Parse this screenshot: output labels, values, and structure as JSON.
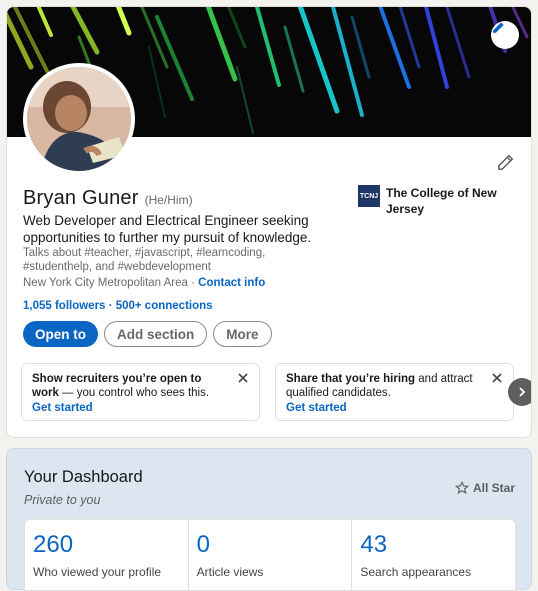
{
  "profile": {
    "name": "Bryan Guner",
    "pronouns": "(He/Him)",
    "headline": "Web Developer and Electrical Engineer seeking opportunities to further my pursuit of knowledge.",
    "talks_about": "Talks about #teacher, #javascript, #learncoding, #studenthelp, and #webdevelopment",
    "location": "New York City Metropolitan Area",
    "location_separator": " · ",
    "contact_info": "Contact info",
    "followers": "1,055 followers",
    "connections_separator": " · ",
    "connections": "500+ connections"
  },
  "school": {
    "logo_text": "TCNJ",
    "name": "The College of New Jersey"
  },
  "actions": {
    "open_to": "Open to",
    "add_section": "Add section",
    "more": "More"
  },
  "suggestions": [
    {
      "text_strong": "Show recruiters you’re open to work",
      "text_rest": " — you control who sees this.",
      "link": "Get started"
    },
    {
      "text_strong": "Share that you’re hiring",
      "text_rest": " and attract qualified candidates.",
      "link": "Get started"
    }
  ],
  "dashboard": {
    "title": "Your Dashboard",
    "subtitle": "Private to you",
    "all_star": "All Star",
    "stats": [
      {
        "value": "260",
        "label": "Who viewed your profile"
      },
      {
        "value": "0",
        "label": "Article views"
      },
      {
        "value": "43",
        "label": "Search appearances"
      }
    ]
  },
  "icons": {
    "banner_edit": "pencil-icon",
    "profile_edit": "pencil-icon",
    "close": "close-icon",
    "next": "chevron-right-icon",
    "all_star": "star-icon"
  },
  "colors": {
    "accent": "#0a66c2",
    "background": "#f3f2ef",
    "dashboard_bg": "#dce6f1"
  }
}
